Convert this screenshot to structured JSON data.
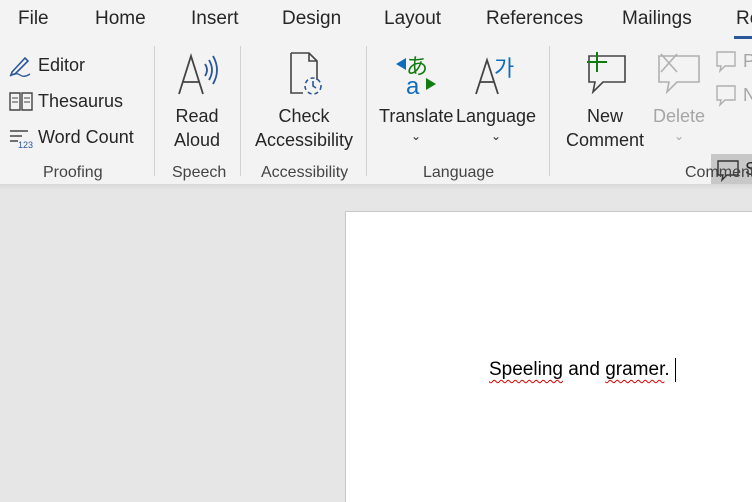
{
  "tabs": [
    "File",
    "Home",
    "Insert",
    "Design",
    "Layout",
    "References",
    "Mailings",
    "Re"
  ],
  "active_tab_index": 7,
  "groups": {
    "proofing": {
      "label": "Proofing",
      "editor": "Editor",
      "thesaurus": "Thesaurus",
      "word_count": "Word Count"
    },
    "speech": {
      "label": "Speech",
      "read_aloud_1": "Read",
      "read_aloud_2": "Aloud"
    },
    "accessibility": {
      "label": "Accessibility",
      "check_1": "Check",
      "check_2": "Accessibility"
    },
    "language": {
      "label": "Language",
      "translate": "Translate",
      "language": "Language",
      "chevron": "⌄"
    },
    "comments": {
      "label": "Comment",
      "new_1": "New",
      "new_2": "Comment",
      "delete": "Delete",
      "prev": "P",
      "next": "N",
      "show": "S"
    }
  },
  "document": {
    "word1": "Speeling",
    "word2": " and ",
    "word3": "gramer",
    "punct": "."
  },
  "colors": {
    "accent": "#2b579a",
    "green": "#107c10",
    "blue": "#0f6cbd",
    "spell_error": "#d00000"
  }
}
